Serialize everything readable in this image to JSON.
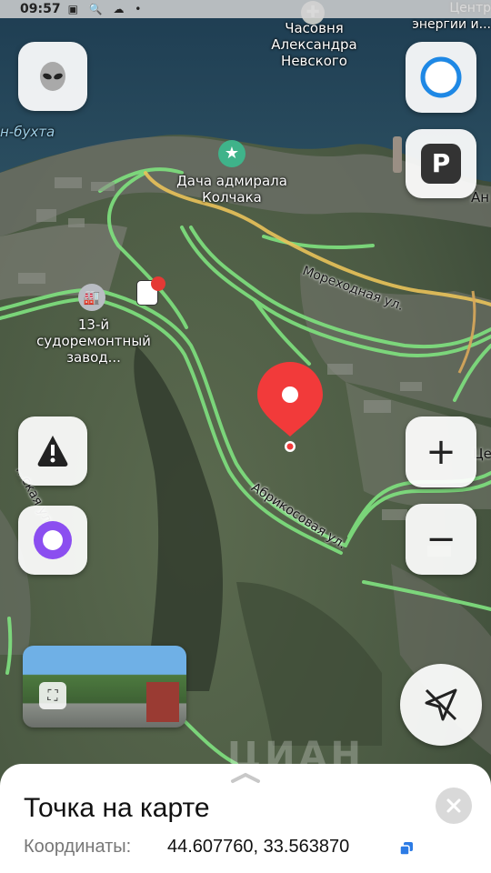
{
  "status_bar": {
    "time": "09:57",
    "icons": "▣ 🔍 ☁ •"
  },
  "map": {
    "places": {
      "chapel": "Часовня\nАлександра\nНевского",
      "top_right": "Центр\nэнергии и...",
      "bay": "н-бухта",
      "dacha": "Дача адмирала\nКолчака",
      "factory": "13-й\nсудоремонтный\nзавод...",
      "right_edge_1": "Ан",
      "right_edge_2": "Це"
    },
    "streets": {
      "morekhodnaya": "Мореходная ул.",
      "abrikosovaya": "Абрикосовая ул.",
      "left_street": "...ская ул."
    },
    "watermark": "ЦИАН",
    "pin_color": "#f23a3a"
  },
  "controls": {
    "avatar_icon": "alien-avatar-icon",
    "assistant_icon": "assistant-ring-icon",
    "parking_label": "P",
    "zoom_in": "+",
    "zoom_out": "−"
  },
  "sheet": {
    "title": "Точка на карте",
    "coord_label": "Координаты:",
    "coord_value": "44.607760, 33.563870"
  }
}
